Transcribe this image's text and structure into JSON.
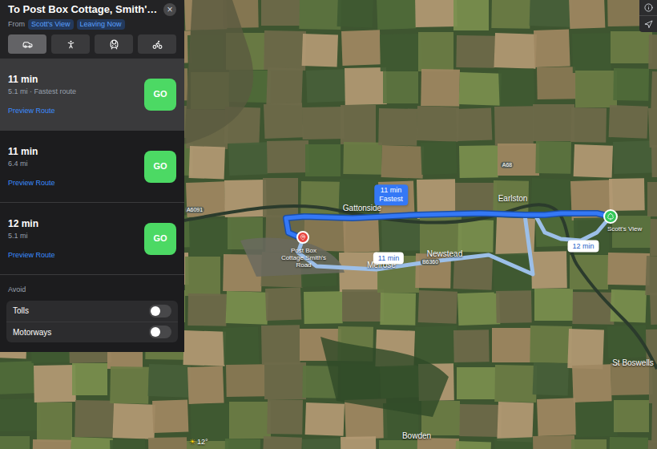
{
  "panel": {
    "title": "To Post Box Cottage, Smith'…",
    "close": "×",
    "from_label": "From",
    "from": "Scott's View",
    "when": "Leaving Now"
  },
  "modes": [
    {
      "kind": "car",
      "selected": true
    },
    {
      "kind": "walk",
      "selected": false
    },
    {
      "kind": "transit",
      "selected": false
    },
    {
      "kind": "cycle",
      "selected": false
    }
  ],
  "routes": [
    {
      "time": "11 min",
      "detail": "5.1 mi · Fastest route",
      "link": "Preview Route",
      "button": "GO",
      "selected": true
    },
    {
      "time": "11 min",
      "detail": "6.4 mi",
      "link": "Preview Route",
      "button": "GO",
      "selected": false
    },
    {
      "time": "12 min",
      "detail": "5.1 mi",
      "link": "Preview Route",
      "button": "GO",
      "selected": false
    }
  ],
  "avoid": {
    "label": "Avoid",
    "options": [
      {
        "label": "Tolls",
        "on": false
      },
      {
        "label": "Motorways",
        "on": false
      }
    ]
  },
  "map": {
    "places": [
      "Earlston",
      "Gattonside",
      "Melrose",
      "Newstead",
      "St Boswells",
      "Bowden"
    ],
    "roads": [
      "A6091",
      "B6360",
      "A68"
    ],
    "pins": [
      {
        "label": "Post Box Cottage Smith's Road",
        "kind": "destination"
      },
      {
        "label": "Scott's View",
        "kind": "origin"
      }
    ],
    "badges": [
      {
        "time": "11 min",
        "note": "Fastest",
        "selected": true
      },
      {
        "time": "11 min",
        "selected": false
      },
      {
        "time": "12 min",
        "selected": false
      }
    ],
    "weather": {
      "icon": "☀",
      "temp": "12°"
    }
  }
}
